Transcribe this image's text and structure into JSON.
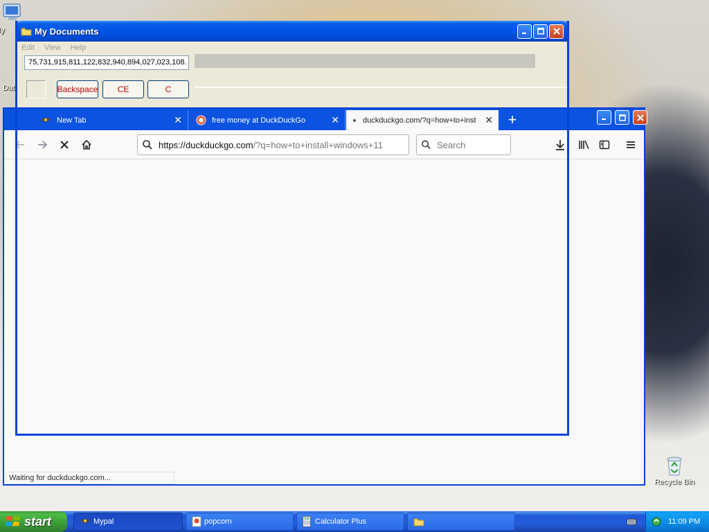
{
  "desktop": {
    "icons": [
      {
        "label": "My",
        "icon": "computer-icon"
      },
      {
        "label": "Dat",
        "icon": "folder-icon"
      },
      {
        "label": "Recycle Bin",
        "icon": "recycle-bin-icon"
      }
    ]
  },
  "mydocs": {
    "title": "My Documents",
    "menu": [
      "Edit",
      "View",
      "Help"
    ],
    "calculator": {
      "display": "75,731,915,811,122,832,940,894,027,023,108.",
      "buttons": [
        "Backspace",
        "CE",
        "C"
      ]
    }
  },
  "firefox": {
    "tabs": [
      {
        "label": "New Tab",
        "icon": "mypal-icon",
        "selected": false
      },
      {
        "label": "free money at DuckDuckGo",
        "icon": "duckduckgo-icon",
        "selected": false
      },
      {
        "label": "duckduckgo.com/?q=how+to+inst",
        "icon": "loading-dot-icon",
        "selected": true
      }
    ],
    "new_tab_symbol": "+",
    "url": {
      "host": "https://duckduckgo.com",
      "rest": "/?q=how+to+install+windows+11"
    },
    "search_placeholder": "Search",
    "status": "Waiting for duckduckgo.com..."
  },
  "taskbar": {
    "start_label": "start",
    "items": [
      {
        "label": "Mypal",
        "icon": "mypal-icon",
        "active": true
      },
      {
        "label": "popcorn",
        "icon": "image-icon",
        "active": false
      },
      {
        "label": "Calculator Plus",
        "icon": "calculator-icon",
        "active": false
      },
      {
        "label": "",
        "icon": "folder-icon",
        "active": false
      }
    ],
    "clock": "11:09 PM"
  },
  "colors": {
    "xp_blue": "#0054e3",
    "start_green": "#3a9a37",
    "tray_blue": "#0c8ae6",
    "calc_red": "#c40000"
  }
}
